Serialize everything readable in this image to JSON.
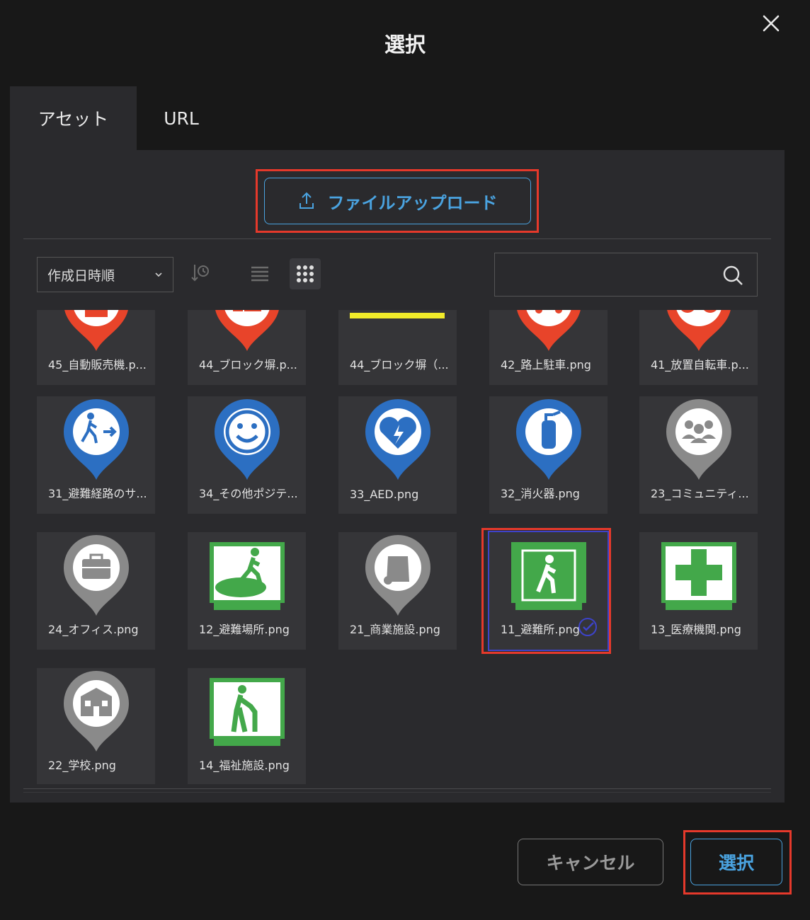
{
  "dialog": {
    "title": "選択"
  },
  "tabs": [
    {
      "label": "アセット"
    },
    {
      "label": "URL"
    }
  ],
  "upload": {
    "label": "ファイルアップロード"
  },
  "sort": {
    "selected": "作成日時順"
  },
  "search": {
    "placeholder": "",
    "value": ""
  },
  "items": [
    {
      "label": "45_自動販売機.p...",
      "icon": "vending-machine-pin-icon",
      "color": "#e8442a"
    },
    {
      "label": "44_ブロック塀.p...",
      "icon": "block-wall-pin-icon",
      "color": "#e8442a"
    },
    {
      "label": "44_ブロック塀（...",
      "icon": "block-wall-line-icon",
      "color": "#f2ec2a"
    },
    {
      "label": "42_路上駐車.png",
      "icon": "parked-car-pin-icon",
      "color": "#e8442a"
    },
    {
      "label": "41_放置自転車.p...",
      "icon": "bicycle-pin-icon",
      "color": "#e8442a"
    },
    {
      "label": "31_避難経路のサ...",
      "icon": "evacuation-route-pin-icon",
      "color": "#2c6fc2"
    },
    {
      "label": "34_その他ポジテ...",
      "icon": "smile-pin-icon",
      "color": "#2c6fc2"
    },
    {
      "label": "33_AED.png",
      "icon": "aed-pin-icon",
      "color": "#2c6fc2"
    },
    {
      "label": "32_消火器.png",
      "icon": "fire-extinguisher-pin-icon",
      "color": "#2c6fc2"
    },
    {
      "label": "23_コミュニティ...",
      "icon": "community-pin-icon",
      "color": "#8a8a8a"
    },
    {
      "label": "24_オフィス.png",
      "icon": "office-pin-icon",
      "color": "#8a8a8a"
    },
    {
      "label": "12_避難場所.png",
      "icon": "evacuation-area-sign-icon",
      "color": "#43a84a"
    },
    {
      "label": "21_商業施設.png",
      "icon": "commercial-pin-icon",
      "color": "#8a8a8a"
    },
    {
      "label": "11_避難所.png",
      "icon": "shelter-sign-icon",
      "color": "#43a84a",
      "selected": true
    },
    {
      "label": "13_医療機関.png",
      "icon": "medical-sign-icon",
      "color": "#43a84a"
    },
    {
      "label": "22_学校.png",
      "icon": "school-pin-icon",
      "color": "#8a8a8a"
    },
    {
      "label": "14_福祉施設.png",
      "icon": "welfare-sign-icon",
      "color": "#43a84a"
    }
  ],
  "footer": {
    "cancel_label": "キャンセル",
    "select_label": "選択"
  },
  "colors": {
    "accent": "#4aa3e0",
    "highlight": "#e5392b",
    "selection": "#3d43c9"
  }
}
